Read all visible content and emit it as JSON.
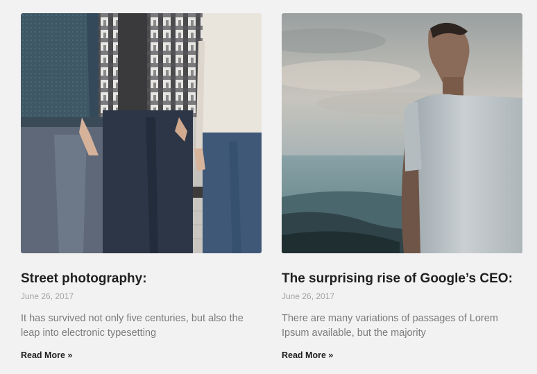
{
  "posts": [
    {
      "image": "people-standing-in-row-photo",
      "title": "Street photography:",
      "date": "June 26, 2017",
      "excerpt": "It has survived not only five centuries, but also the leap into electronic typesetting",
      "read_more": "Read More »"
    },
    {
      "image": "man-looking-at-mountains-photo",
      "title": "The surprising rise of Google’s CEO:",
      "date": "June 26, 2017",
      "excerpt": "There are many variations of passages of Lorem Ipsum available, but the majority",
      "read_more": "Read More »"
    }
  ]
}
